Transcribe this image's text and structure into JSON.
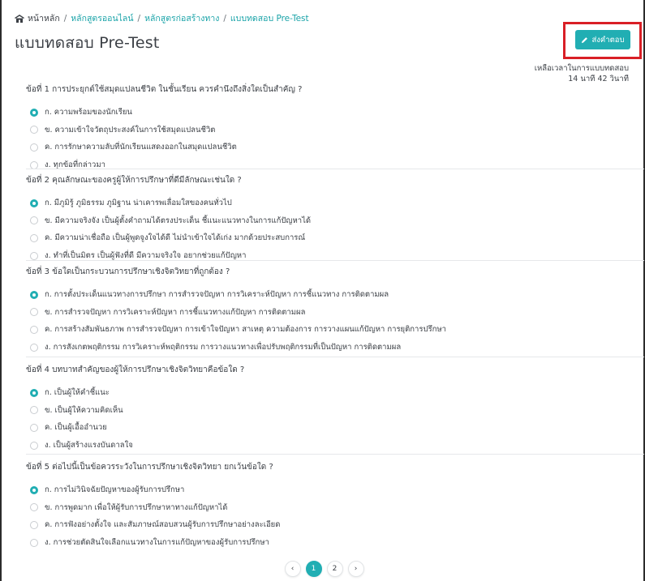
{
  "breadcrumb": {
    "home": "หน้าหลัก",
    "items": [
      "หลักสูตรออนไลน์",
      "หลักสูตรก่อสร้างทาง",
      "แบบทดสอบ Pre-Test"
    ],
    "separator": "/"
  },
  "page_title": "แบบทดสอบ Pre-Test",
  "submit_label": "ส่งคำตอบ",
  "timer": {
    "label": "เหลือเวลาในการแบบทดสอบ",
    "value": "14 นาที 42 วินาที"
  },
  "colors": {
    "accent": "#21aeb3",
    "highlight": "#d91f26"
  },
  "questions": [
    {
      "text": "ข้อที่ 1 การประยุกต์ใช้สมุดแปลนชีวิต ในชั้นเรียน ควรคำนึงถึงสิ่งใดเป็นสำคัญ ?",
      "selected": 0,
      "options": [
        "ก. ความพร้อมของนักเรียน",
        "ข. ความเข้าใจวัตถุประสงค์ในการใช้สมุดแปลนชีวิต",
        "ค. การรักษาความลับที่นักเรียนแสดงออกในสมุดแปลนชีวิต",
        "ง. ทุกข้อที่กล่าวมา"
      ]
    },
    {
      "text": "ข้อที่ 2 คุณลักษณะของครูผู้ให้การปรึกษาที่ดีมีลักษณะเช่นใด ?",
      "selected": 0,
      "options": [
        "ก. มีภูมิรู้ ภูมิธรรม ภูมิฐาน น่าเคารพเลื่อมใสของคนทั่วไป",
        "ข. มีความจริงจัง เป็นผู้ตั้งคำถามได้ตรงประเด็น ชี้แนะแนวทางในการแก้ปัญหาได้",
        "ค. มีความน่าเชื่อถือ เป็นผู้พูดจูงใจได้ดี ไม่นำเข้าใจได้เก่ง มากด้วยประสบการณ์",
        "ง. ทำที่เป็นมิตร เป็นผู้ฟังที่ดี มีความจริงใจ อยากช่วยแก้ปัญหา"
      ]
    },
    {
      "text": "ข้อที่ 3 ข้อใดเป็นกระบวนการปรึกษาเชิงจิตวิทยาที่ถูกต้อง ?",
      "selected": 0,
      "options": [
        "ก. การตั้งประเด็นแนวทางการปรึกษา การสำรวจปัญหา การวิเคราะห์ปัญหา การชี้แนวทาง การติดตามผล",
        "ข. การสำรวจปัญหา การวิเคราะห์ปัญหา การชี้แนวทางแก้ปัญหา การติดตามผล",
        "ค. การสร้างสัมพันธภาพ การสำรวจปัญหา การเข้าใจปัญหา สาเหตุ ความต้องการ การวางแผนแก้ปัญหา การยุติการปรึกษา",
        "ง. การสังเกตพฤติกรรม การวิเคราะห์พฤติกรรม การวางแนวทางเพื่อปรับพฤติกรรมที่เป็นปัญหา การติดตามผล"
      ]
    },
    {
      "text": "ข้อที่ 4 บทบาทสำคัญของผู้ให้การปรึกษาเชิงจิตวิทยาคือข้อใด ?",
      "selected": 0,
      "options": [
        "ก. เป็นผู้ให้คำชี้แนะ",
        "ข. เป็นผู้ให้ความคิดเห็น",
        "ค. เป็นผู้เอื้ออำนวย",
        "ง. เป็นผู้สร้างแรงบันดาลใจ"
      ]
    },
    {
      "text": "ข้อที่ 5 ต่อไปนี้เป็นข้อควรระวังในการปรึกษาเชิงจิตวิทยา ยกเว้นข้อใด ?",
      "selected": 0,
      "options": [
        "ก. การไม่วินิจฉัยปัญหาของผู้รับการปรึกษา",
        "ข. การพูดมาก เพื่อให้ผู้รับการปรึกษาหาทางแก้ปัญหาได้",
        "ค. การฟังอย่างตั้งใจ และสัมภาษณ์สอบสวนผู้รับการปรึกษาอย่างละเอียด",
        "ง. การช่วยตัดสินใจเลือกแนวทางในการแก้ปัญหาของผู้รับการปรึกษา"
      ]
    }
  ],
  "pagination": {
    "prev": "‹",
    "pages": [
      "1",
      "2"
    ],
    "current": "1",
    "next": "›"
  }
}
